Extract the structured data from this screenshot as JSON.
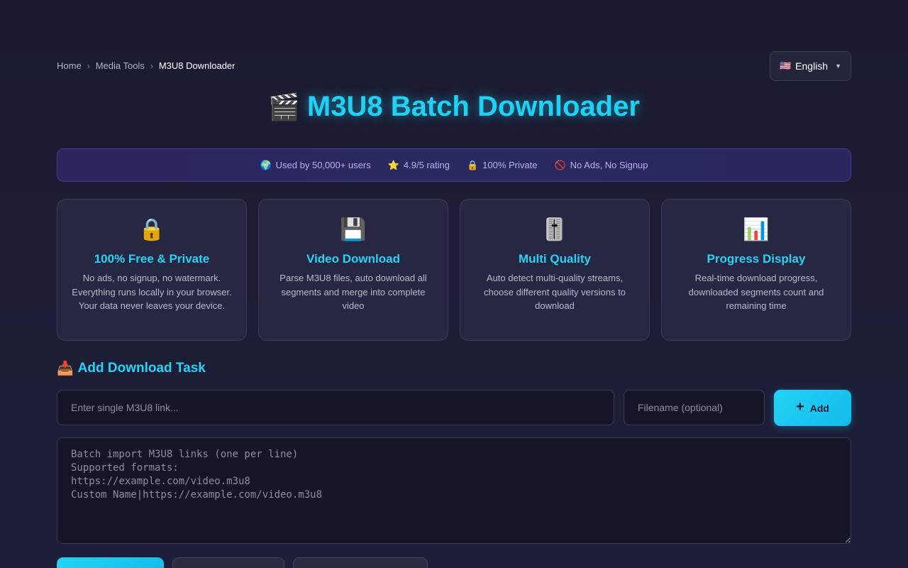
{
  "breadcrumb": {
    "items": [
      "Home",
      "Media Tools",
      "M3U8 Downloader"
    ],
    "separator": "›"
  },
  "language": {
    "flag": "🇺🇸",
    "label": "English",
    "caret": "▼"
  },
  "title": {
    "icon": "🎬",
    "text": "M3U8 Batch Downloader"
  },
  "stats": [
    {
      "icon": "🌍",
      "text": "Used by 50,000+ users"
    },
    {
      "icon": "⭐",
      "text": "4.9/5 rating"
    },
    {
      "icon": "🔒",
      "text": "100% Private"
    },
    {
      "icon": "🚫",
      "text": "No Ads, No Signup"
    }
  ],
  "features": [
    {
      "icon": "🔒",
      "title": "100% Free & Private",
      "desc": "No ads, no signup, no watermark. Everything runs locally in your browser. Your data never leaves your device."
    },
    {
      "icon": "💾",
      "title": "Video Download",
      "desc": "Parse M3U8 files, auto download all segments and merge into complete video"
    },
    {
      "icon": "🎚️",
      "title": "Multi Quality",
      "desc": "Auto detect multi-quality streams, choose different quality versions to download"
    },
    {
      "icon": "📊",
      "title": "Progress Display",
      "desc": "Real-time download progress, downloaded segments count and remaining time"
    }
  ],
  "add_task": {
    "icon": "📥",
    "heading": "Add Download Task",
    "url_placeholder": "Enter single M3U8 link...",
    "filename_placeholder": "Filename (optional)",
    "add_icon": "+",
    "add_label": "Add",
    "batch_placeholder": "Batch import M3U8 links (one per line)\nSupported formats:\nhttps://example.com/video.m3u8\nCustom Name|https://example.com/video.m3u8"
  },
  "colors": {
    "accent": "#1fd1f5",
    "background": "#1c1d35",
    "card": "#262843",
    "banner": "#2c2560",
    "banner_text": "#b8b2f2"
  }
}
